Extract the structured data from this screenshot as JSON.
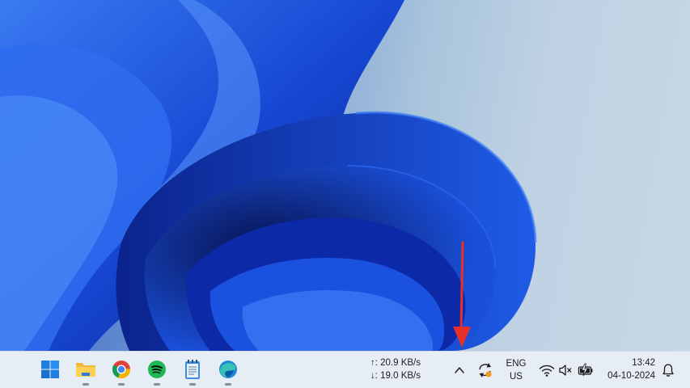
{
  "colors": {
    "taskbar_bg": "#e7edf5",
    "annotation_arrow": "#e8302a",
    "wallpaper_blue": "#1746d6",
    "wallpaper_bg": "#bfd2e3"
  },
  "taskbar": {
    "pinned": [
      {
        "name": "start-button",
        "icon": "windows-logo-icon",
        "running": false
      },
      {
        "name": "file-explorer",
        "icon": "folder-icon",
        "running": true
      },
      {
        "name": "chrome",
        "icon": "chrome-icon",
        "running": true
      },
      {
        "name": "spotify",
        "icon": "spotify-icon",
        "running": true
      },
      {
        "name": "notepad",
        "icon": "notepad-icon",
        "running": true
      },
      {
        "name": "edge",
        "icon": "edge-icon",
        "running": true
      }
    ],
    "network_speed": {
      "upload": "↑: 20.9 KB/s",
      "download": "↓: 19.0 KB/s"
    },
    "tray": {
      "overflow_icon": "chevron-up-icon",
      "sync_icon": "sync-icon",
      "language": "ENG",
      "region": "US",
      "wifi_icon": "wifi-icon",
      "volume_icon": "volume-muted-icon",
      "battery_icon": "battery-charging-icon",
      "notification_icon": "bell-icon"
    },
    "clock": {
      "time": "13:42",
      "date": "04-10-2024"
    }
  }
}
